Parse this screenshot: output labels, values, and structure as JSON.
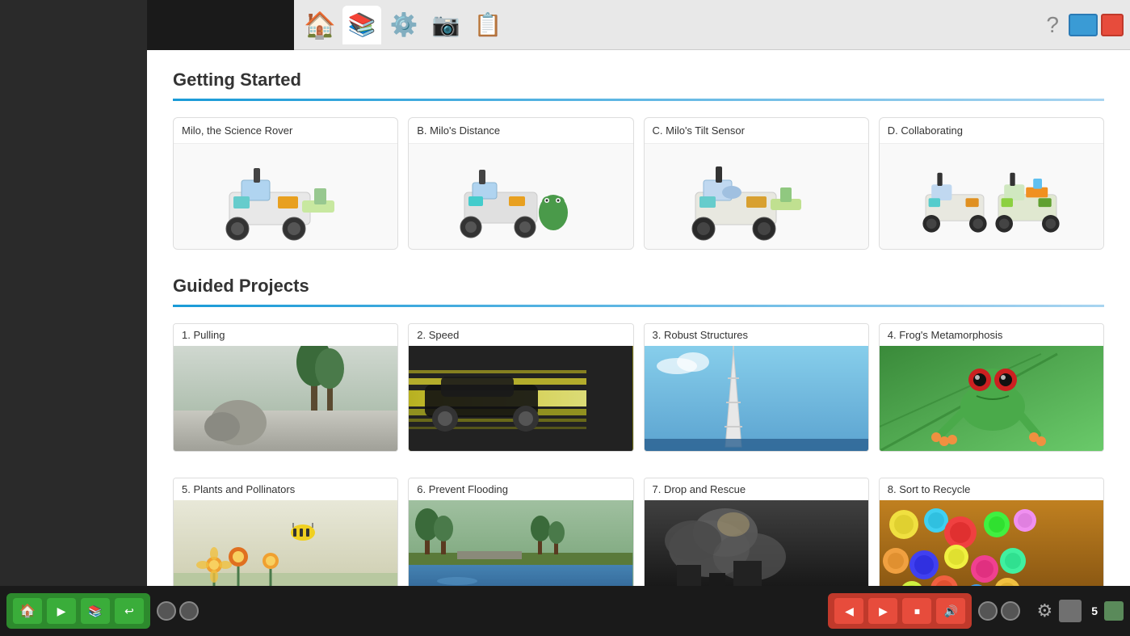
{
  "toolbar": {
    "home_label": "🏠",
    "book_label": "📚",
    "gear_label": "⚙️",
    "camera_label": "📷",
    "notes_label": "📋",
    "help_label": "?",
    "page_number": "5"
  },
  "getting_started": {
    "title": "Getting Started",
    "cards": [
      {
        "label": "Milo, the Science Rover",
        "id": "milo-science"
      },
      {
        "label": "B. Milo's Distance",
        "id": "milos-distance"
      },
      {
        "label": "C. Milo's Tilt Sensor",
        "id": "milos-tilt"
      },
      {
        "label": "D. Collaborating",
        "id": "collaborating"
      }
    ]
  },
  "guided_projects": {
    "title": "Guided Projects",
    "row1": [
      {
        "label": "1. Pulling",
        "id": "pulling",
        "img_class": "img-pulling"
      },
      {
        "label": "2. Speed",
        "id": "speed",
        "img_class": "img-speed"
      },
      {
        "label": "3. Robust Structures",
        "id": "robust",
        "img_class": "img-robust"
      },
      {
        "label": "4. Frog's Metamorphosis",
        "id": "frog",
        "img_class": "img-frog"
      }
    ],
    "row2": [
      {
        "label": "5. Plants and Pollinators",
        "id": "plants",
        "img_class": "img-plants"
      },
      {
        "label": "6. Prevent Flooding",
        "id": "flood",
        "img_class": "img-flood"
      },
      {
        "label": "7. Drop and Rescue",
        "id": "drop",
        "img_class": "img-drop"
      },
      {
        "label": "8. Sort to Recycle",
        "id": "recycle",
        "img_class": "img-recycle"
      }
    ]
  }
}
